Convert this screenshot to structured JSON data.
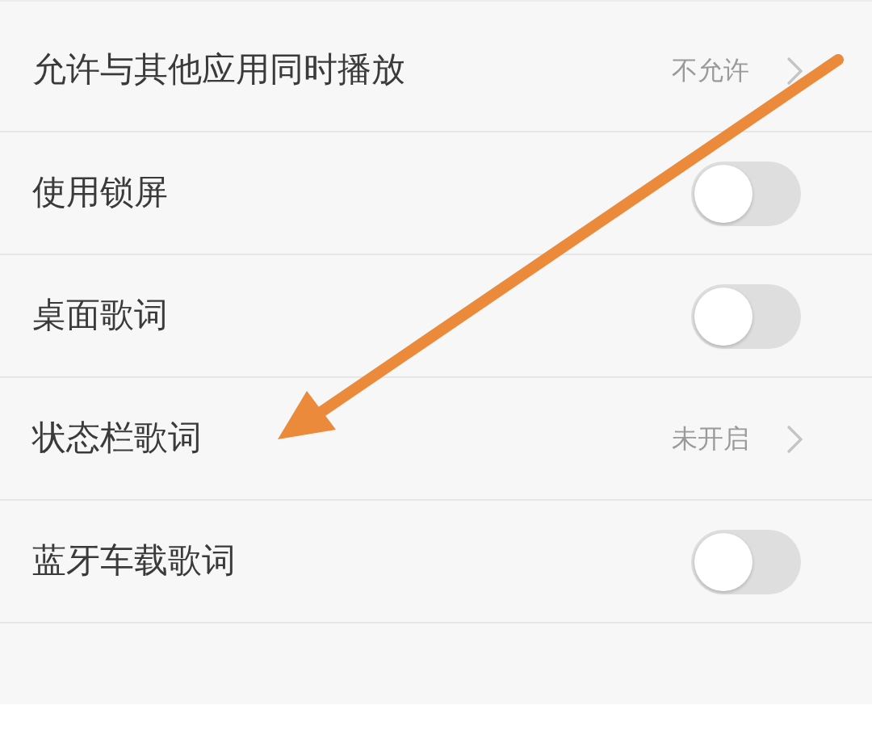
{
  "settings": [
    {
      "kind": "value",
      "label": "允许与其他应用同时播放",
      "value": "不允许"
    },
    {
      "kind": "toggle",
      "label": "使用锁屏",
      "on": false
    },
    {
      "kind": "toggle",
      "label": "桌面歌词",
      "on": false
    },
    {
      "kind": "value",
      "label": "状态栏歌词",
      "value": "未开启"
    },
    {
      "kind": "toggle",
      "label": "蓝牙车载歌词",
      "on": false
    },
    {
      "kind": "blank"
    }
  ]
}
